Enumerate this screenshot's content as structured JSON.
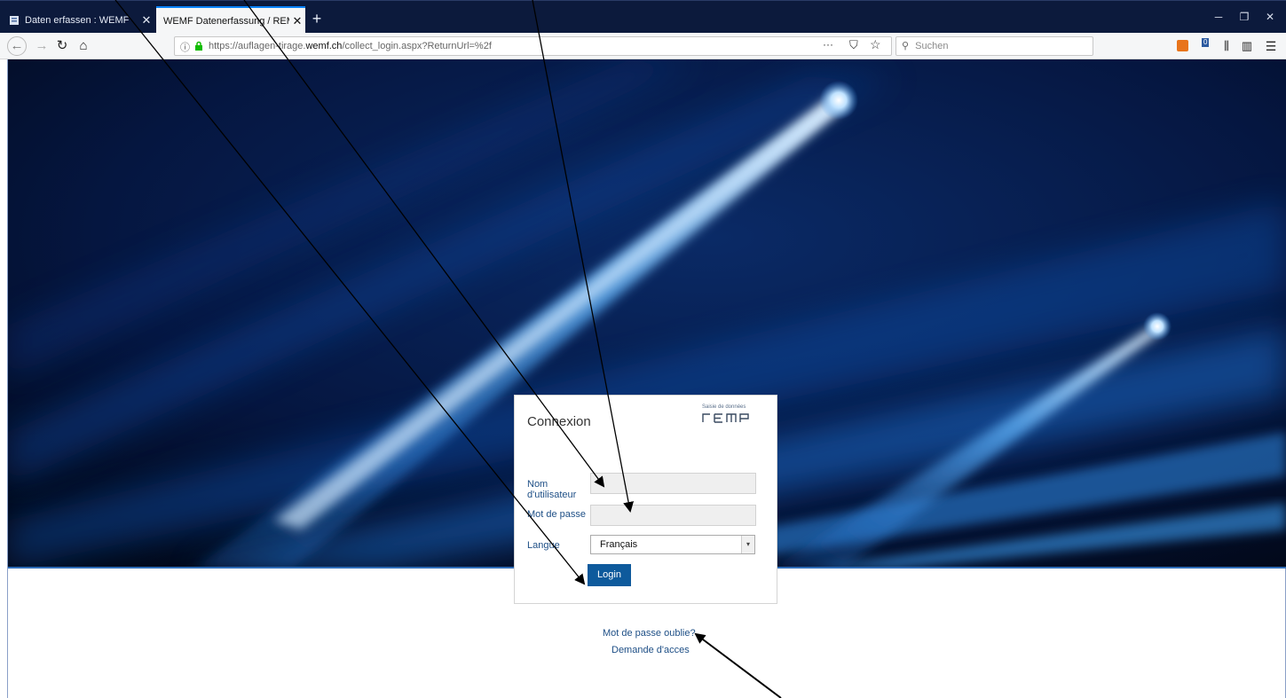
{
  "browser": {
    "tabs": [
      {
        "title": "Daten erfassen : WEMF",
        "active": false
      },
      {
        "title": "WEMF Datenerfassung / REMP as",
        "active": true
      }
    ],
    "url": {
      "prefix": "https://auflagen-tirage.",
      "domain": "wemf.ch",
      "path": "/collect_login.aspx?ReturnUrl=%2f"
    },
    "search_placeholder": "Suchen",
    "page_actions": "···",
    "ext_badge": "0"
  },
  "login": {
    "title": "Connexion",
    "logo_subtitle": "Saisie de données",
    "logo_text": "remp",
    "username_label": "Nom d'utilisateur",
    "password_label": "Mot de passe",
    "language_label": "Langue",
    "language_value": "Français",
    "login_button": "Login"
  },
  "links": {
    "forgot_password": "Mot de passe oublie?",
    "request_access": "Demande d'acces"
  },
  "colors": {
    "tabbar_bg": "#0c1a3c",
    "accent": "#0e5a9c",
    "link": "#1e4f86"
  }
}
